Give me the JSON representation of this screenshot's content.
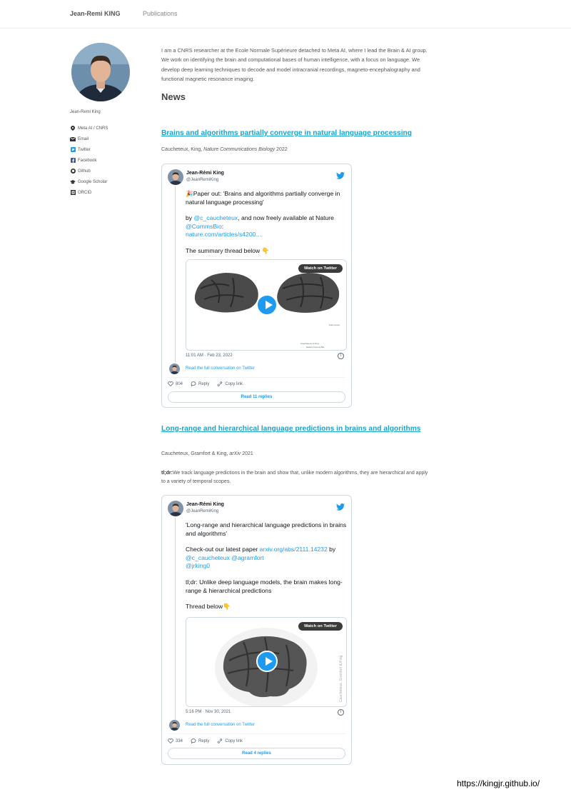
{
  "nav": {
    "brand": "Jean-Remi KING",
    "publications": "Publications"
  },
  "sidebar": {
    "name": "Jean-Remi King",
    "links": [
      {
        "label": "Meta AI / CNRS",
        "icon": "map-marker-icon"
      },
      {
        "label": "Email",
        "icon": "envelope-icon"
      },
      {
        "label": "Twitter",
        "icon": "twitter-icon"
      },
      {
        "label": "Facebook",
        "icon": "facebook-icon"
      },
      {
        "label": "Github",
        "icon": "github-icon"
      },
      {
        "label": "Google Scholar",
        "icon": "graduation-cap-icon"
      },
      {
        "label": "ORCID",
        "icon": "orcid-icon"
      }
    ]
  },
  "bio": "I am a CNRS researcher at the Ecole Normale Supérieure detached to Meta AI, where I lead the Brain & AI group. We work on identifying the brain and computational bases of human intelligence, with a focus on language. We develop deep learning techniques to decode and model intracranial recordings, magneto-encephalography and functional magnetic resonance imaging.",
  "news_heading": "News",
  "posts": [
    {
      "title": "Brains and algorithms partially converge in natural language processing",
      "authors": "Caucheteux, King, ",
      "venue": "Nature Communications Biology",
      "year": " 2022",
      "tweet": {
        "name": "Jean-Rémi King",
        "handle": "@JeanRemiKing",
        "p1": "🎉Paper out: 'Brains and algorithms partially converge in natural language processing'",
        "p2_pre": "by ",
        "p2_link1": "@c_caucheteux",
        "p2_mid": ", and now freely available at Nature ",
        "p2_link2": "@CommsBio",
        "p2_colon": ":",
        "p2_link3": "nature.com/articles/s4200…",
        "p3": "The summary thread below 👇",
        "watch": "Watch on Twitter",
        "time": "11:01 AM · Feb 23, 2022",
        "conversation": "Read the full conversation on Twitter",
        "likes": "804",
        "reply": "Reply",
        "copy": "Copy link",
        "replies": "Read 11 replies"
      }
    },
    {
      "title": "Long-range and hierarchical language predictions in brains and algorithms",
      "authors": "Caucheteux, Gramfort & King, ",
      "venue": "arXiv",
      "year": " 2021",
      "tldr_label": "tl;dr:",
      "tldr": "We track language predictions in the brain and show that, unlike modern algorithms, they are hierarchical and apply to a variety of temporal scopes.",
      "tweet": {
        "name": "Jean-Rémi King",
        "handle": "@JeanRemiKing",
        "p1": "'Long-range and hierarchical language predictions in brains and algorithms'",
        "p2_pre": "Check-out our latest paper ",
        "p2_link1": "arxiv.org/abs/2111.14232",
        "p2_mid": " by ",
        "p2_link2": "@c_caucheteux",
        "p2_sp": " ",
        "p2_link3": "@agramfort",
        "p2_link4": "@jrking0",
        "p3": "tl;dr: Unlike deep language models, the brain makes long-range & hierarchical predictions",
        "p4": "Thread below👇",
        "watch": "Watch on Twitter",
        "media_caption": "Caucheteux, Gramfort & King",
        "time": "5:16 PM · Nov 30, 2021",
        "conversation": "Read the full conversation on Twitter",
        "likes": "334",
        "reply": "Reply",
        "copy": "Copy link",
        "replies": "Read 4 replies"
      }
    }
  ],
  "footer_url": "https://kingjr.github.io/",
  "colors": {
    "link": "#1aa3c8",
    "twitter_blue": "#1d9bf0"
  }
}
